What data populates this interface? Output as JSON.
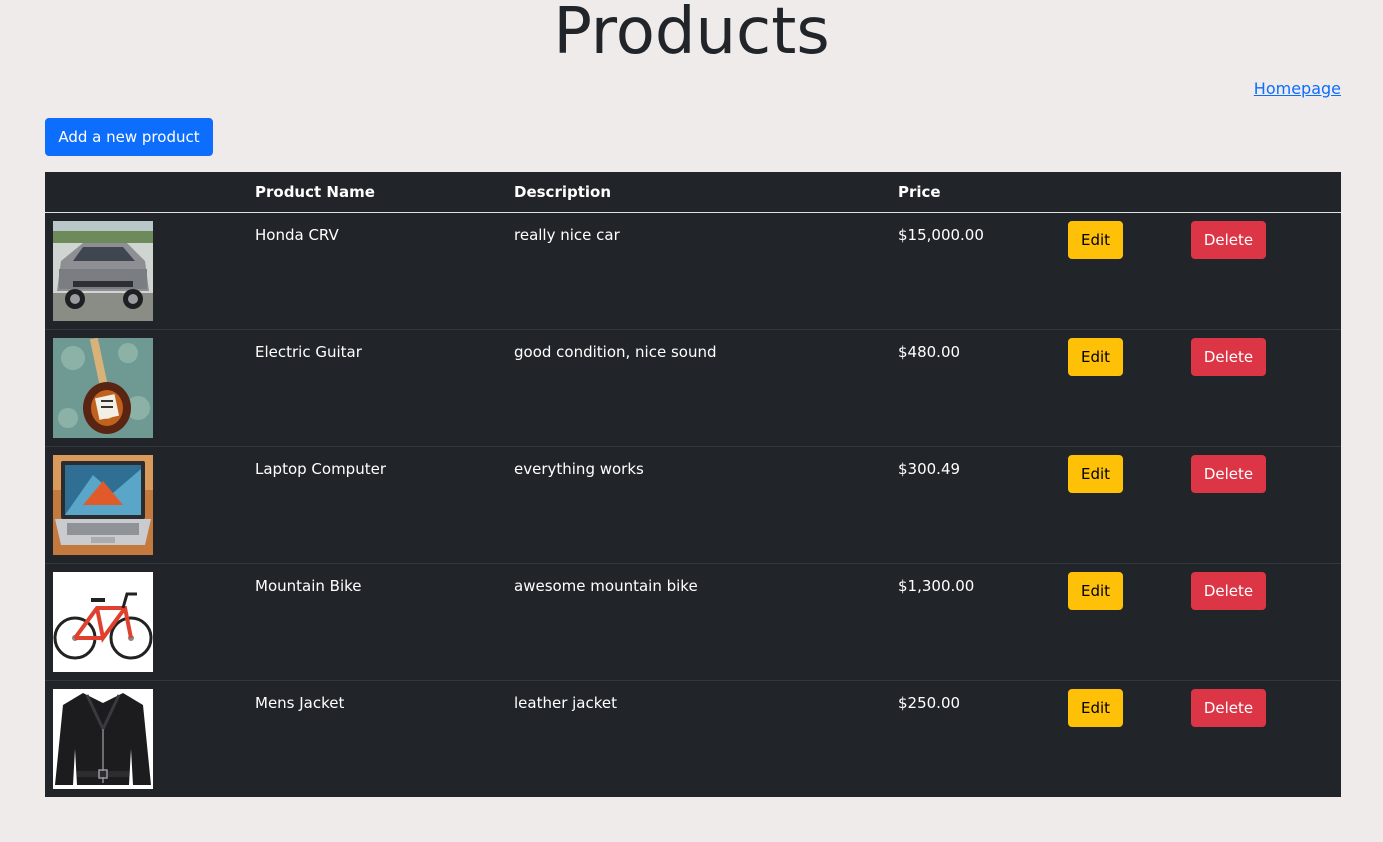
{
  "page": {
    "title": "Products",
    "homepage_link": "Homepage",
    "add_button": "Add a new product"
  },
  "colors": {
    "background": "#efebea",
    "primary": "#0d6efd",
    "table_dark": "#212529",
    "warning": "#ffc107",
    "danger": "#dc3545"
  },
  "table": {
    "headers": [
      "",
      "Product Name",
      "Description",
      "Price",
      "",
      ""
    ],
    "rows": [
      {
        "image": "car-photo",
        "name": "Honda CRV",
        "description": "really nice car",
        "price": "$15,000.00",
        "edit": "Edit",
        "delete": "Delete"
      },
      {
        "image": "guitar-photo",
        "name": "Electric Guitar",
        "description": "good condition, nice sound",
        "price": "$480.00",
        "edit": "Edit",
        "delete": "Delete"
      },
      {
        "image": "laptop-photo",
        "name": "Laptop Computer",
        "description": "everything works",
        "price": "$300.49",
        "edit": "Edit",
        "delete": "Delete"
      },
      {
        "image": "bike-photo",
        "name": "Mountain Bike",
        "description": "awesome mountain bike",
        "price": "$1,300.00",
        "edit": "Edit",
        "delete": "Delete"
      },
      {
        "image": "jacket-photo",
        "name": "Mens Jacket",
        "description": "leather jacket",
        "price": "$250.00",
        "edit": "Edit",
        "delete": "Delete"
      }
    ]
  }
}
